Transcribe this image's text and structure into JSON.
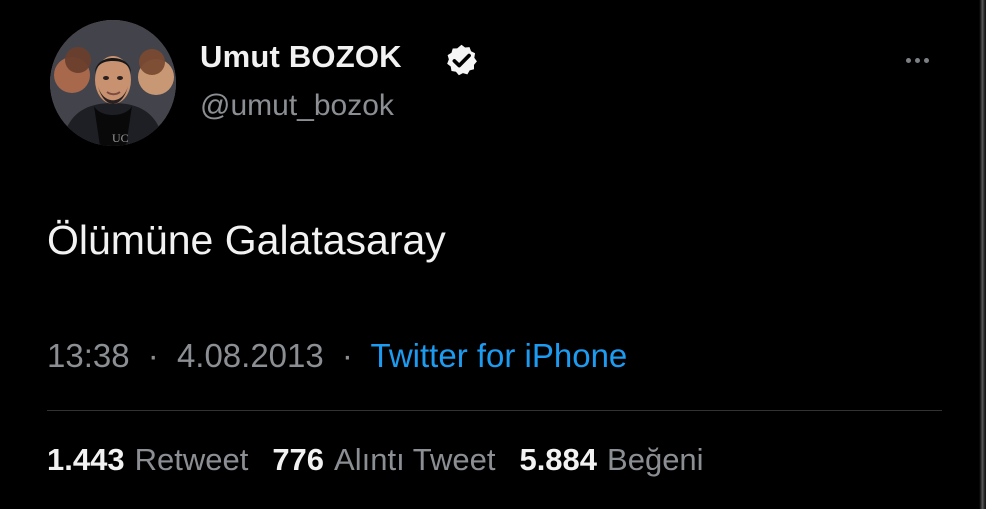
{
  "author": {
    "display_name": "Umut BOZOK",
    "handle": "@umut_bozok",
    "verified_icon": "verified-badge-icon",
    "verified_color": "#f5f5f5"
  },
  "actions": {
    "more_icon": "more-horizontal-icon"
  },
  "tweet": {
    "text": "Ölümüne Galatasaray",
    "time": "13:38",
    "separator": "·",
    "date": "4.08.2013",
    "source": "Twitter for iPhone"
  },
  "stats": {
    "retweets": {
      "count": "1.443",
      "label": "Retweet"
    },
    "quotes": {
      "count": "776",
      "label": "Alıntı Tweet"
    },
    "likes": {
      "count": "5.884",
      "label": "Beğeni"
    }
  },
  "colors": {
    "background": "#000000",
    "primary_text": "#f2f2f2",
    "secondary_text": "#8b8f93",
    "link": "#1d9bf0",
    "divider": "#2f3336"
  }
}
